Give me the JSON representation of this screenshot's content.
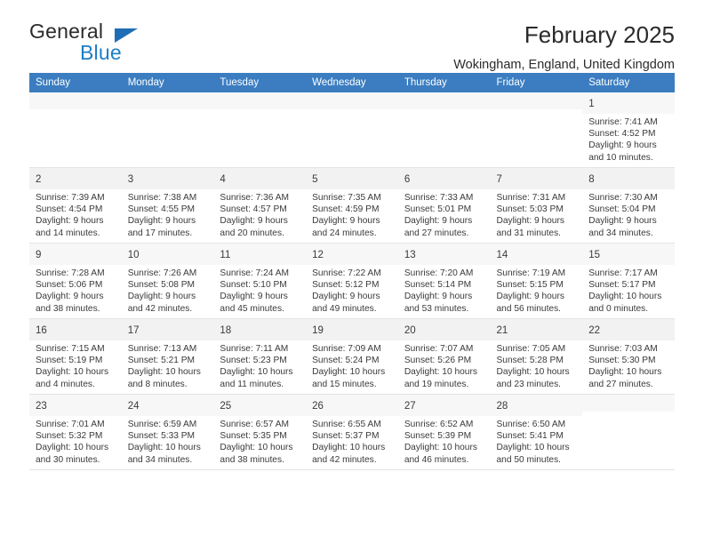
{
  "brand": {
    "name_part1": "General",
    "name_part2": "Blue",
    "mark": "triangle-logo"
  },
  "header": {
    "title": "February 2025",
    "location": "Wokingham, England, United Kingdom"
  },
  "weekday_headers": [
    "Sunday",
    "Monday",
    "Tuesday",
    "Wednesday",
    "Thursday",
    "Friday",
    "Saturday"
  ],
  "colors": {
    "header_blue": "#3b7dc0",
    "brand_blue": "#1d7ec4",
    "text": "#3a3a3a",
    "row_shade": "#f2f2f2",
    "cell_bar": "#f7f7f7"
  },
  "weeks": [
    [
      {
        "blank": true
      },
      {
        "blank": true
      },
      {
        "blank": true
      },
      {
        "blank": true
      },
      {
        "blank": true
      },
      {
        "blank": true
      },
      {
        "day": "1",
        "sunrise": "Sunrise: 7:41 AM",
        "sunset": "Sunset: 4:52 PM",
        "daylight1": "Daylight: 9 hours",
        "daylight2": "and 10 minutes."
      }
    ],
    [
      {
        "day": "2",
        "sunrise": "Sunrise: 7:39 AM",
        "sunset": "Sunset: 4:54 PM",
        "daylight1": "Daylight: 9 hours",
        "daylight2": "and 14 minutes."
      },
      {
        "day": "3",
        "sunrise": "Sunrise: 7:38 AM",
        "sunset": "Sunset: 4:55 PM",
        "daylight1": "Daylight: 9 hours",
        "daylight2": "and 17 minutes."
      },
      {
        "day": "4",
        "sunrise": "Sunrise: 7:36 AM",
        "sunset": "Sunset: 4:57 PM",
        "daylight1": "Daylight: 9 hours",
        "daylight2": "and 20 minutes."
      },
      {
        "day": "5",
        "sunrise": "Sunrise: 7:35 AM",
        "sunset": "Sunset: 4:59 PM",
        "daylight1": "Daylight: 9 hours",
        "daylight2": "and 24 minutes."
      },
      {
        "day": "6",
        "sunrise": "Sunrise: 7:33 AM",
        "sunset": "Sunset: 5:01 PM",
        "daylight1": "Daylight: 9 hours",
        "daylight2": "and 27 minutes."
      },
      {
        "day": "7",
        "sunrise": "Sunrise: 7:31 AM",
        "sunset": "Sunset: 5:03 PM",
        "daylight1": "Daylight: 9 hours",
        "daylight2": "and 31 minutes."
      },
      {
        "day": "8",
        "sunrise": "Sunrise: 7:30 AM",
        "sunset": "Sunset: 5:04 PM",
        "daylight1": "Daylight: 9 hours",
        "daylight2": "and 34 minutes."
      }
    ],
    [
      {
        "day": "9",
        "sunrise": "Sunrise: 7:28 AM",
        "sunset": "Sunset: 5:06 PM",
        "daylight1": "Daylight: 9 hours",
        "daylight2": "and 38 minutes."
      },
      {
        "day": "10",
        "sunrise": "Sunrise: 7:26 AM",
        "sunset": "Sunset: 5:08 PM",
        "daylight1": "Daylight: 9 hours",
        "daylight2": "and 42 minutes."
      },
      {
        "day": "11",
        "sunrise": "Sunrise: 7:24 AM",
        "sunset": "Sunset: 5:10 PM",
        "daylight1": "Daylight: 9 hours",
        "daylight2": "and 45 minutes."
      },
      {
        "day": "12",
        "sunrise": "Sunrise: 7:22 AM",
        "sunset": "Sunset: 5:12 PM",
        "daylight1": "Daylight: 9 hours",
        "daylight2": "and 49 minutes."
      },
      {
        "day": "13",
        "sunrise": "Sunrise: 7:20 AM",
        "sunset": "Sunset: 5:14 PM",
        "daylight1": "Daylight: 9 hours",
        "daylight2": "and 53 minutes."
      },
      {
        "day": "14",
        "sunrise": "Sunrise: 7:19 AM",
        "sunset": "Sunset: 5:15 PM",
        "daylight1": "Daylight: 9 hours",
        "daylight2": "and 56 minutes."
      },
      {
        "day": "15",
        "sunrise": "Sunrise: 7:17 AM",
        "sunset": "Sunset: 5:17 PM",
        "daylight1": "Daylight: 10 hours",
        "daylight2": "and 0 minutes."
      }
    ],
    [
      {
        "day": "16",
        "sunrise": "Sunrise: 7:15 AM",
        "sunset": "Sunset: 5:19 PM",
        "daylight1": "Daylight: 10 hours",
        "daylight2": "and 4 minutes."
      },
      {
        "day": "17",
        "sunrise": "Sunrise: 7:13 AM",
        "sunset": "Sunset: 5:21 PM",
        "daylight1": "Daylight: 10 hours",
        "daylight2": "and 8 minutes."
      },
      {
        "day": "18",
        "sunrise": "Sunrise: 7:11 AM",
        "sunset": "Sunset: 5:23 PM",
        "daylight1": "Daylight: 10 hours",
        "daylight2": "and 11 minutes."
      },
      {
        "day": "19",
        "sunrise": "Sunrise: 7:09 AM",
        "sunset": "Sunset: 5:24 PM",
        "daylight1": "Daylight: 10 hours",
        "daylight2": "and 15 minutes."
      },
      {
        "day": "20",
        "sunrise": "Sunrise: 7:07 AM",
        "sunset": "Sunset: 5:26 PM",
        "daylight1": "Daylight: 10 hours",
        "daylight2": "and 19 minutes."
      },
      {
        "day": "21",
        "sunrise": "Sunrise: 7:05 AM",
        "sunset": "Sunset: 5:28 PM",
        "daylight1": "Daylight: 10 hours",
        "daylight2": "and 23 minutes."
      },
      {
        "day": "22",
        "sunrise": "Sunrise: 7:03 AM",
        "sunset": "Sunset: 5:30 PM",
        "daylight1": "Daylight: 10 hours",
        "daylight2": "and 27 minutes."
      }
    ],
    [
      {
        "day": "23",
        "sunrise": "Sunrise: 7:01 AM",
        "sunset": "Sunset: 5:32 PM",
        "daylight1": "Daylight: 10 hours",
        "daylight2": "and 30 minutes."
      },
      {
        "day": "24",
        "sunrise": "Sunrise: 6:59 AM",
        "sunset": "Sunset: 5:33 PM",
        "daylight1": "Daylight: 10 hours",
        "daylight2": "and 34 minutes."
      },
      {
        "day": "25",
        "sunrise": "Sunrise: 6:57 AM",
        "sunset": "Sunset: 5:35 PM",
        "daylight1": "Daylight: 10 hours",
        "daylight2": "and 38 minutes."
      },
      {
        "day": "26",
        "sunrise": "Sunrise: 6:55 AM",
        "sunset": "Sunset: 5:37 PM",
        "daylight1": "Daylight: 10 hours",
        "daylight2": "and 42 minutes."
      },
      {
        "day": "27",
        "sunrise": "Sunrise: 6:52 AM",
        "sunset": "Sunset: 5:39 PM",
        "daylight1": "Daylight: 10 hours",
        "daylight2": "and 46 minutes."
      },
      {
        "day": "28",
        "sunrise": "Sunrise: 6:50 AM",
        "sunset": "Sunset: 5:41 PM",
        "daylight1": "Daylight: 10 hours",
        "daylight2": "and 50 minutes."
      },
      {
        "blank": true
      }
    ]
  ]
}
